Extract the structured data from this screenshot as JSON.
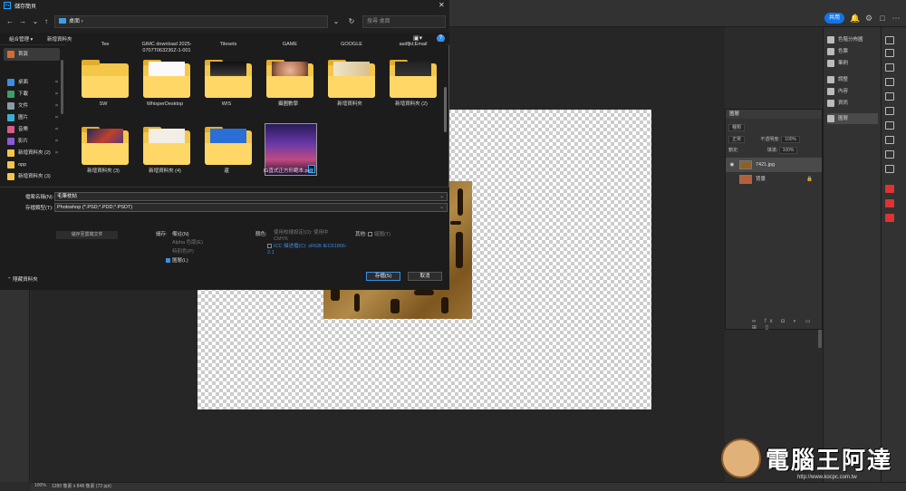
{
  "ps": {
    "search_placeholder": "",
    "share_label": "共用",
    "status_zoom": "100%",
    "status_size": "1280 像素 x 848 像素 (72 ppi)",
    "docks": [
      {
        "name": "swatches",
        "label": "色階分佈圖"
      },
      {
        "name": "color",
        "label": "色票"
      },
      {
        "name": "brushes",
        "label": "筆刷"
      },
      {
        "name": "adjust",
        "label": "調整"
      },
      {
        "name": "props",
        "label": "內容"
      },
      {
        "name": "info",
        "label": "資訊"
      },
      {
        "name": "layers",
        "label": "圖層"
      }
    ],
    "layers_panel": {
      "title": "圖層",
      "filter": "種類",
      "blend": "正常",
      "opacity_label": "不透明度:",
      "opacity": "100%",
      "lock_label": "鎖定:",
      "fill_label": "填滿:",
      "fill": "100%",
      "layers": [
        {
          "name": "7421.jpg",
          "active": true
        },
        {
          "name": "背景",
          "active": false
        }
      ],
      "footer_icons": "∞ fx ◘ ◐ ▭ ⊞ ▯"
    },
    "watermark": {
      "text": "電腦王阿達",
      "url": "http://www.kocpc.com.tw"
    }
  },
  "dialog": {
    "title": "儲存簡貝",
    "address": "桌面",
    "search_placeholder": "搜尋 桌面",
    "organize": "組合管理 ▾",
    "new_folder": "新增資料夾",
    "cut_labels": [
      "Tee",
      "GIMC download 2025-0707T063236Z-1-001",
      "Tilesets",
      "GAME",
      "GOOGLE",
      "asdfjkl;Email"
    ],
    "nav_items": [
      {
        "name": "home",
        "label": "首頁",
        "color": "#d86b2b"
      },
      {
        "name": "desktop",
        "label": "桌面",
        "color": "#3a8ee6"
      },
      {
        "name": "downloads",
        "label": "下載",
        "color": "#3aa06a"
      },
      {
        "name": "documents",
        "label": "文件",
        "color": "#8a9aa8"
      },
      {
        "name": "pictures",
        "label": "圖片",
        "color": "#3ab0d0"
      },
      {
        "name": "music",
        "label": "音樂",
        "color": "#d85a8a"
      },
      {
        "name": "videos",
        "label": "影片",
        "color": "#8a5ad8"
      },
      {
        "name": "newfolder2",
        "label": "新增資料夾 (2)",
        "color": "#f4c64a"
      },
      {
        "name": "opp",
        "label": "opp",
        "color": "#f4c64a"
      },
      {
        "name": "newfolder3",
        "label": "新增資料夾 (3)",
        "color": "#f4c64a"
      }
    ],
    "files_row1": [
      {
        "label": "SW",
        "peek": ""
      },
      {
        "label": "WhisperDesktop",
        "peek": "doc"
      },
      {
        "label": "WIS",
        "peek": "dark"
      },
      {
        "label": "攝圖數學",
        "peek": "face"
      },
      {
        "label": "新增資料夾",
        "peek": "paper"
      },
      {
        "label": "新增資料夾 (2)",
        "peek": "dark2"
      }
    ],
    "files_row2": [
      {
        "label": "新增資料夾 (3)",
        "peek": "tv"
      },
      {
        "label": "新增資料夾 (4)",
        "peek": "doc2"
      },
      {
        "label": "還",
        "peek": "word"
      },
      {
        "label": "IG直式正方形範本.psd",
        "peek": "photo"
      }
    ],
    "filename_label": "檔案名稱(N):",
    "filename_value": "毛筆枕帖",
    "filetype_label": "存檔類型(T):",
    "filetype_value": "Photoshop (*.PSD;*.PDD;*.PSDT)",
    "save_cloud": "儲存至雲端文件",
    "save_label": "儲存:",
    "save_opts": [
      {
        "label": "備註(N)",
        "dim": false,
        "check": false
      },
      {
        "label": "Alpha 色版(E)",
        "dim": true,
        "check": false
      },
      {
        "label": "特別色(P)",
        "dim": true,
        "check": false
      },
      {
        "label": "圖層(L)",
        "dim": false,
        "check": true
      }
    ],
    "color_label": "顏色:",
    "color_opt1": "使用校樣設定(O): 使用中 CMYK",
    "color_opt2": "ICC 描述檔(C): sRGB IEC61966-2.1",
    "other_label": "其他:",
    "other_opt": "縮圖(T)",
    "save_button": "存檔(S)",
    "cancel_button": "取消",
    "hide_folders": "隱藏資料夾"
  }
}
